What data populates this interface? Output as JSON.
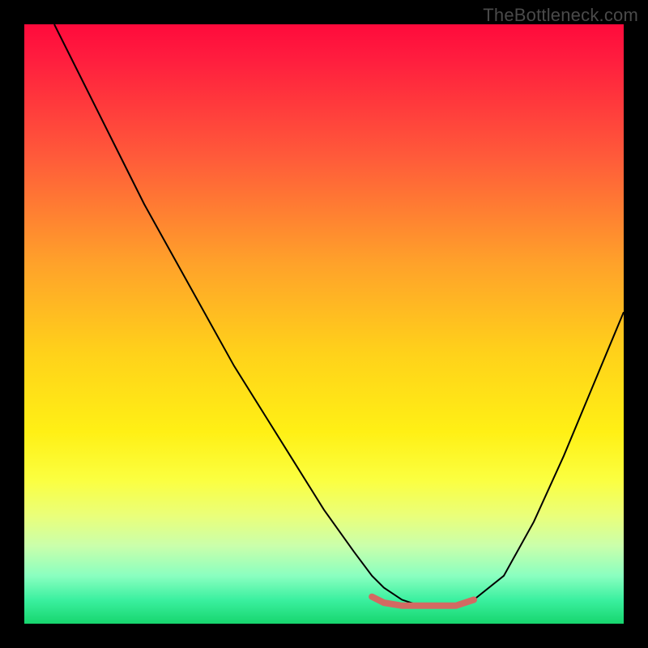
{
  "watermark": "TheBottleneck.com",
  "chart_data": {
    "type": "line",
    "title": "",
    "xlabel": "",
    "ylabel": "",
    "xlim": [
      0,
      100
    ],
    "ylim": [
      0,
      100
    ],
    "grid": false,
    "legend": false,
    "background_gradient": {
      "orientation": "vertical",
      "stops": [
        {
          "pos": 5,
          "color": "#ff0a3c"
        },
        {
          "pos": 50,
          "color": "#ffd21a"
        },
        {
          "pos": 90,
          "color": "#17d66e"
        }
      ]
    },
    "series": [
      {
        "name": "bottleneck-curve",
        "color": "#000000",
        "x": [
          5,
          10,
          15,
          20,
          25,
          30,
          35,
          40,
          45,
          50,
          55,
          58,
          60,
          63,
          66,
          70,
          72,
          75,
          80,
          85,
          90,
          95,
          100
        ],
        "y": [
          100,
          90,
          80,
          70,
          61,
          52,
          43,
          35,
          27,
          19,
          12,
          8,
          6,
          4,
          3,
          3,
          3,
          4,
          8,
          17,
          28,
          40,
          52
        ]
      },
      {
        "name": "valley-highlight",
        "color": "#d36a62",
        "stroke_width": 8,
        "x": [
          58,
          60,
          63,
          66,
          70,
          72,
          75
        ],
        "y": [
          4.5,
          3.5,
          3,
          3,
          3,
          3,
          4
        ]
      }
    ]
  }
}
